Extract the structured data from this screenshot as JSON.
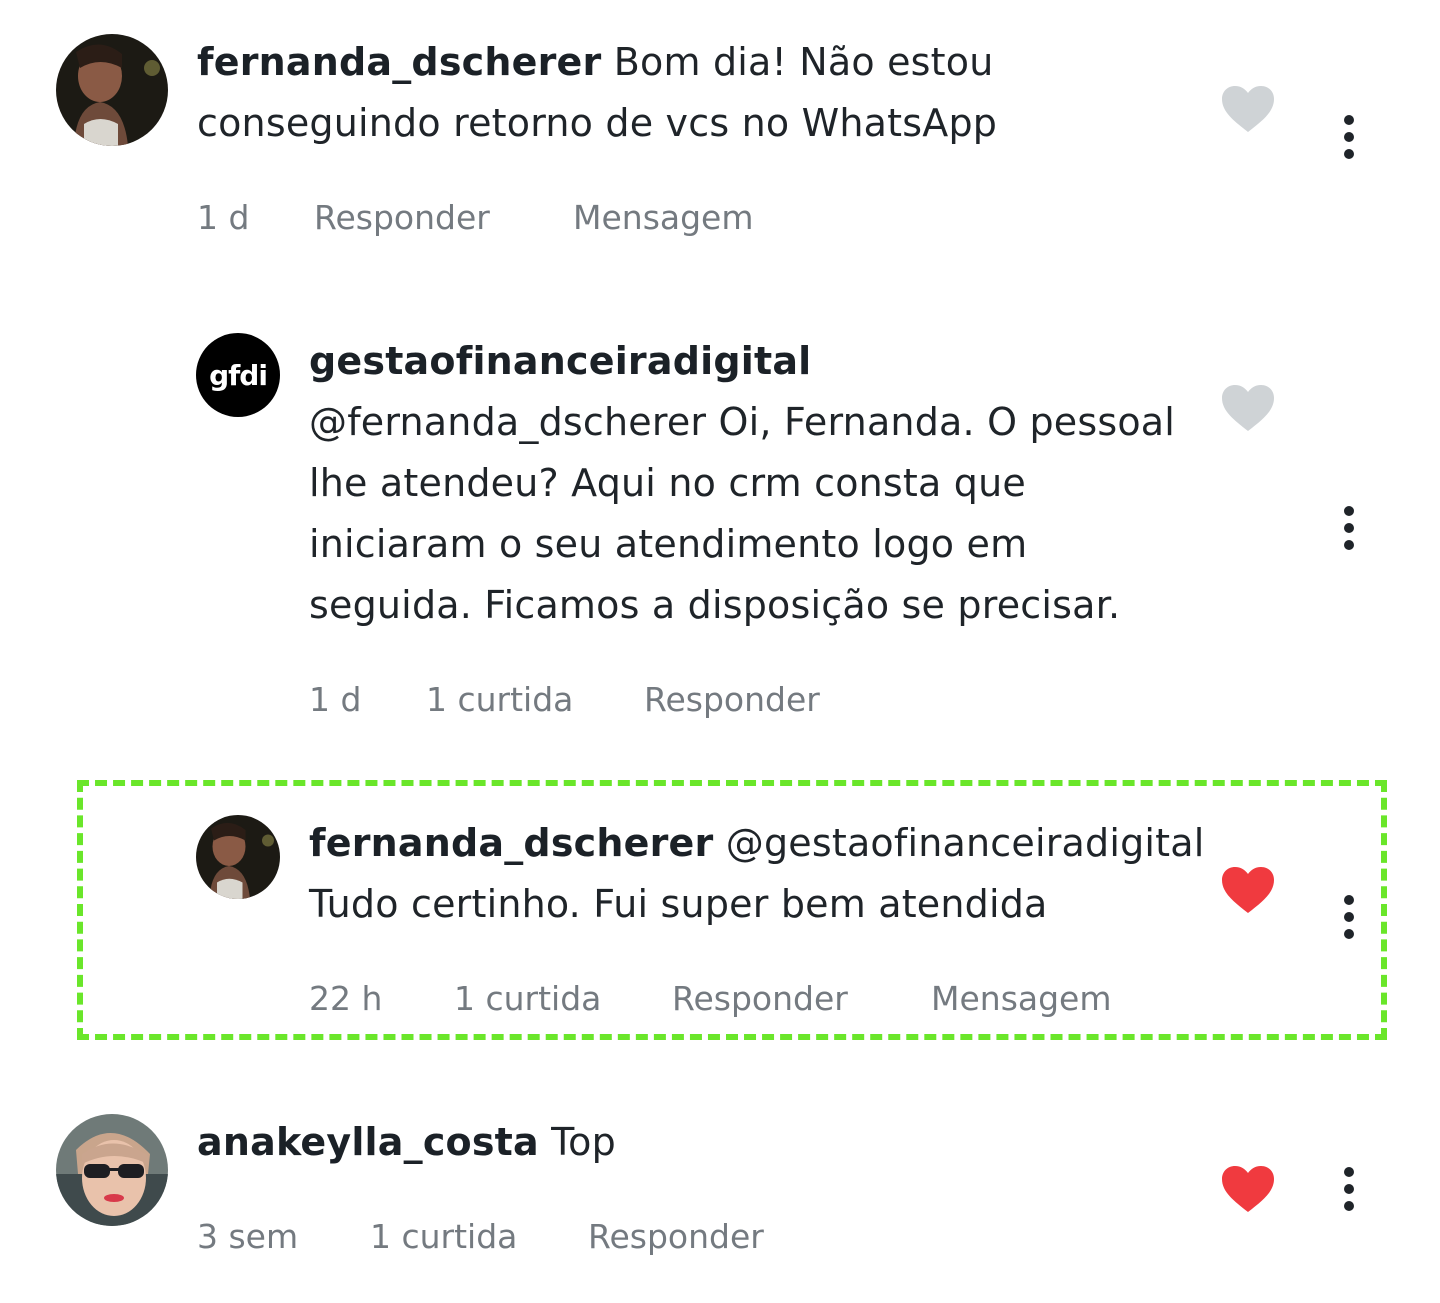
{
  "comments": [
    {
      "username": "fernanda_dscherer",
      "text": "Bom dia! Não estou conseguindo retorno de vcs no WhatsApp",
      "time": "1 d",
      "reply": "Responder",
      "message": "Mensagem",
      "liked": false,
      "avatar_icon": "user-photo-fernanda"
    },
    {
      "username": "gestaofinanceiradigital",
      "text": "@fernanda_dscherer Oi, Fernanda. O pessoal lhe atendeu? Aqui no crm consta que iniciaram o seu atendimento logo em seguida. Ficamos a disposição se precisar.",
      "time": "1 d",
      "likes": "1 curtida",
      "reply": "Responder",
      "liked": false,
      "avatar_logo": "gfdi"
    },
    {
      "username": "fernanda_dscherer",
      "text": "@gestaofinanceiradigital Tudo certinho. Fui super bem atendida",
      "time": "22 h",
      "likes": "1 curtida",
      "reply": "Responder",
      "message": "Mensagem",
      "liked": true,
      "highlighted": true,
      "avatar_icon": "user-photo-fernanda"
    },
    {
      "username": "anakeylla_costa",
      "text": "Top",
      "time": "3 sem",
      "likes": "1 curtida",
      "reply": "Responder",
      "liked": true,
      "avatar_icon": "user-photo-anakeylla"
    }
  ],
  "colors": {
    "heart_liked": "#f03a3f",
    "heart_unliked": "#cfd3d6",
    "meta_text": "#747a80",
    "highlight_border": "#6ae62a"
  },
  "icons": {
    "heart": "heart-icon",
    "more": "more-vertical-icon"
  }
}
